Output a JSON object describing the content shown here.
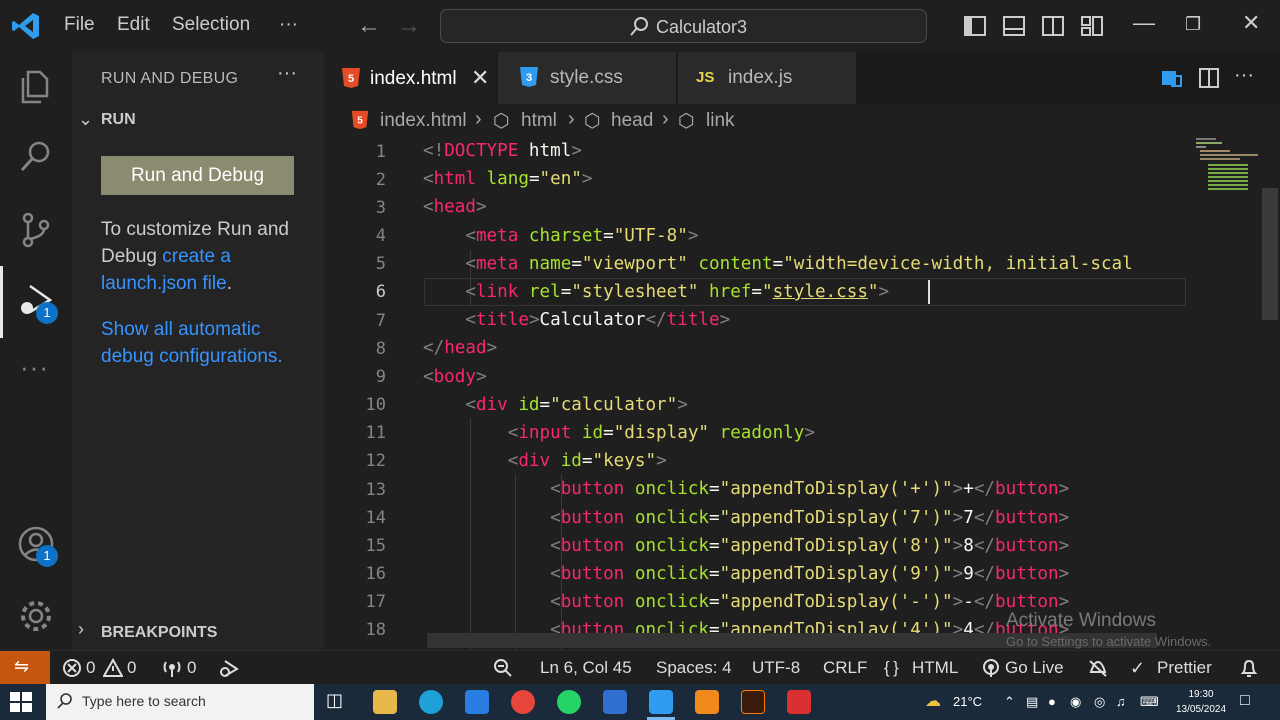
{
  "titlebar": {
    "menu": [
      "File",
      "Edit",
      "Selection",
      "···"
    ],
    "search_text": "Calculator3"
  },
  "activity_bar": {
    "debug_badge": "1",
    "account_badge": "1"
  },
  "sidebar": {
    "title": "RUN AND DEBUG",
    "run_section": "RUN",
    "run_button": "Run and Debug",
    "customize_text": "To customize Run and Debug ",
    "create_link": "create a launch.json file",
    "period": ".",
    "show_all_link": "Show all automatic debug configurations.",
    "breakpoints_section": "BREAKPOINTS"
  },
  "tabs": [
    {
      "label": "index.html",
      "icon": "html5-icon",
      "active": true
    },
    {
      "label": "style.css",
      "icon": "css-icon",
      "active": false
    },
    {
      "label": "index.js",
      "icon": "js-icon",
      "active": false
    }
  ],
  "tab_close": "✕",
  "breadcrumb": [
    "index.html",
    "html",
    "head",
    "link"
  ],
  "editor": {
    "line_numbers": [
      "1",
      "2",
      "3",
      "4",
      "5",
      "6",
      "7",
      "8",
      "9",
      "10",
      "11",
      "12",
      "13",
      "14",
      "15",
      "16",
      "17",
      "18"
    ],
    "current_line": 6,
    "watermark_title": "Activate Windows",
    "watermark_sub": "Go to Settings to activate Windows."
  },
  "statusbar": {
    "errors": "0",
    "warnings": "0",
    "ports": "0",
    "position": "Ln 6, Col 45",
    "spaces": "Spaces: 4",
    "encoding": "UTF-8",
    "eol": "CRLF",
    "language": "HTML",
    "go_live": "Go Live",
    "prettier": "Prettier"
  },
  "taskbar": {
    "search_placeholder": "Type here to search",
    "temperature": "21°C",
    "time": "19:30",
    "date": "13/05/2024"
  },
  "colors": {
    "accent": "#0e72c6",
    "remote": "#c4560e",
    "tag": "#f92672",
    "attr": "#a6e22e",
    "string": "#e6db74"
  }
}
